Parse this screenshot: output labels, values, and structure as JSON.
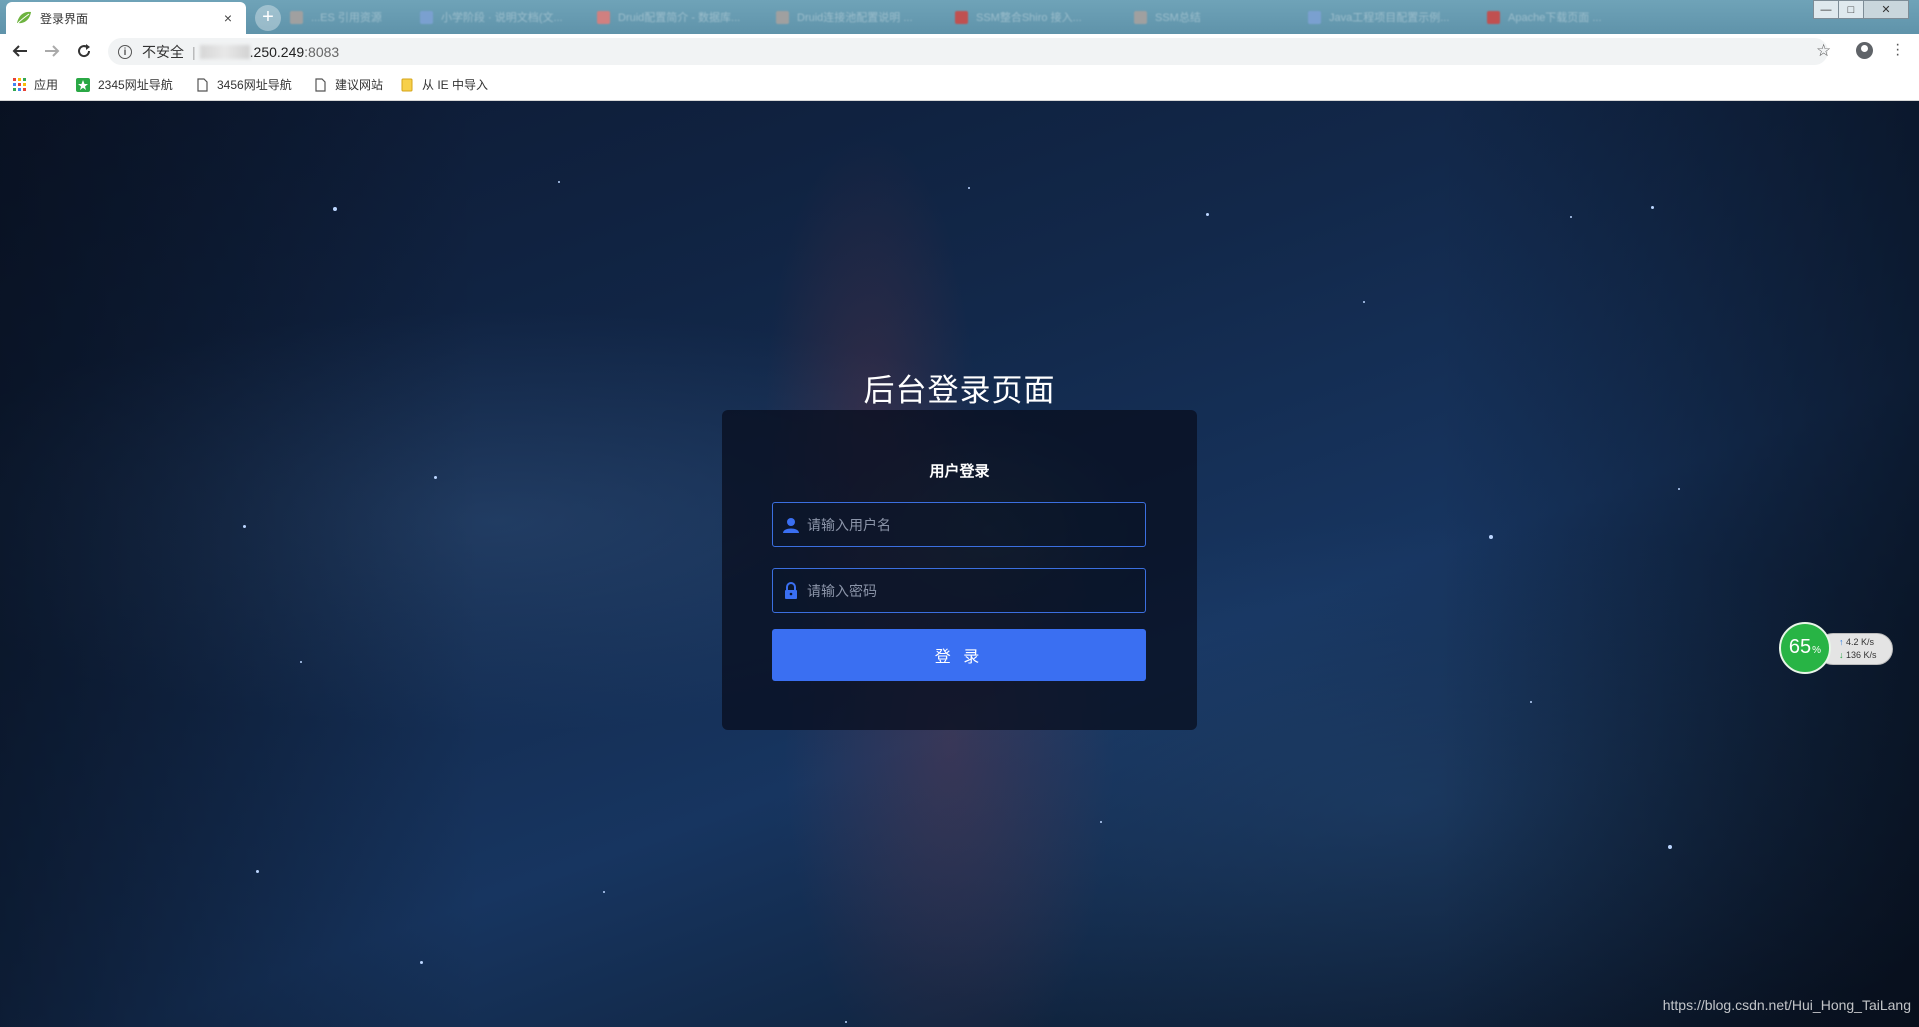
{
  "browser": {
    "active_tab": {
      "title": "登录界面",
      "close_symbol": "×"
    },
    "new_tab_symbol": "+",
    "background_tabs": [
      {
        "title": "...ES 引用资源",
        "color": "#a0a0a0"
      },
      {
        "title": "小学阶段 · 说明文档(文...",
        "color": "#7aa0d0"
      },
      {
        "title": "Druid配置简介 - 数据库...",
        "color": "#d08080"
      },
      {
        "title": "Druid连接池配置说明 ...",
        "color": "#a0a0a0"
      },
      {
        "title": "SSM整合Shiro 接入...",
        "color": "#c05050"
      },
      {
        "title": "SSM总结",
        "color": "#a0a0a0"
      },
      {
        "title": "Java工程项目配置示例...",
        "color": "#7aa0d0"
      },
      {
        "title": "Apache下载页面 ...",
        "color": "#c05050"
      }
    ],
    "window_controls": {
      "minimize": "—",
      "maximize": "□",
      "close": "✕"
    },
    "address_bar": {
      "security_label": "不安全",
      "host_visible": ".250.249",
      "port": ":8083"
    },
    "bookmarks": [
      {
        "label": "应用",
        "icon": "apps-grid-icon"
      },
      {
        "label": "2345网址导航",
        "icon": "2345-logo-icon"
      },
      {
        "label": "3456网址导航",
        "icon": "page-icon"
      },
      {
        "label": "建议网站",
        "icon": "page-icon"
      },
      {
        "label": "从 IE 中导入",
        "icon": "folder-icon"
      }
    ]
  },
  "login_page": {
    "page_title": "后台登录页面",
    "form_heading": "用户登录",
    "username_placeholder": "请输入用户名",
    "password_placeholder": "请输入密码",
    "submit_label": "登 录",
    "accent_color": "#3a6ff2"
  },
  "network_monitor": {
    "percent": "65",
    "percent_sign": "%",
    "upload_rate": "4.2 K/s",
    "download_rate": "136 K/s"
  },
  "watermark": "https://blog.csdn.net/Hui_Hong_TaiLang"
}
